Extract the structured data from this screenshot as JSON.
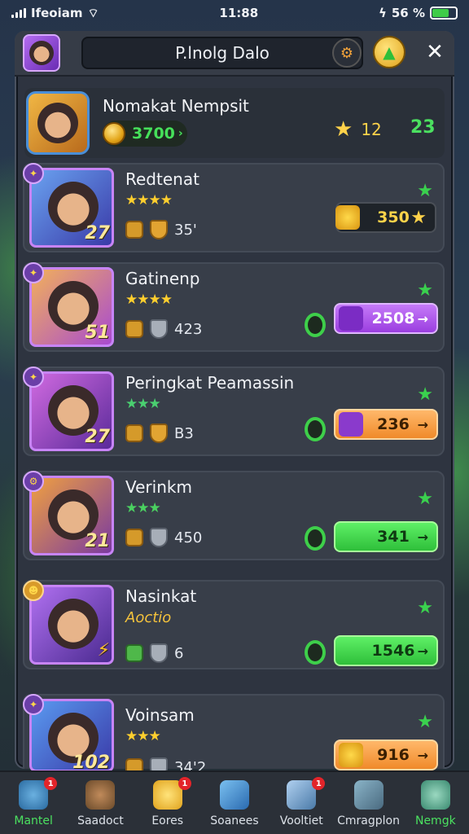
{
  "status": {
    "carrier": "Ifeoiam",
    "time": "11:88",
    "battery": "56 %"
  },
  "header": {
    "title": "P.lnolg Dalo"
  },
  "player": {
    "name": "Nomakat Nempsit",
    "gold": "3700",
    "stars": "12",
    "rank": "23"
  },
  "rows": [
    {
      "name": "Redtenat",
      "stars": "★★★★",
      "level": "27",
      "stat": "35'",
      "price": "350",
      "btn": "dark"
    },
    {
      "name": "Gatinenp",
      "stars": "★★★★",
      "level": "51",
      "stat": "423",
      "price": "2508",
      "btn": "purple"
    },
    {
      "name": "Peringkat Peamassin",
      "stars": "★★★",
      "level": "27",
      "stat": "B3",
      "price": "236",
      "btn": "orange"
    },
    {
      "name": "Verinkm",
      "stars": "★★★",
      "level": "21",
      "stat": "450",
      "price": "341",
      "btn": "green"
    },
    {
      "name": "Nasinkat",
      "sub": "Aoctio",
      "level": "",
      "stat": "6",
      "price": "1546",
      "btn": "green"
    },
    {
      "name": "Voinsam",
      "stars": "★★★",
      "level": "102",
      "stat": "34'2",
      "price": "916",
      "btn": "orange"
    }
  ],
  "nav": [
    {
      "label": "Mantel",
      "badge": "1"
    },
    {
      "label": "Saadoct",
      "badge": ""
    },
    {
      "label": "Eores",
      "badge": "1"
    },
    {
      "label": "Soanees",
      "badge": ""
    },
    {
      "label": "Vooltiet",
      "badge": "1"
    },
    {
      "label": "Cmragplon",
      "badge": ""
    },
    {
      "label": "Nemgk",
      "badge": ""
    }
  ],
  "colors": {
    "accent_green": "#3ecf4a",
    "gold": "#ffcf2e",
    "purple": "#c784f6"
  },
  "icons": {
    "close": "close-icon",
    "coin": "coin-icon",
    "star": "star-icon",
    "shield": "shield-icon"
  }
}
